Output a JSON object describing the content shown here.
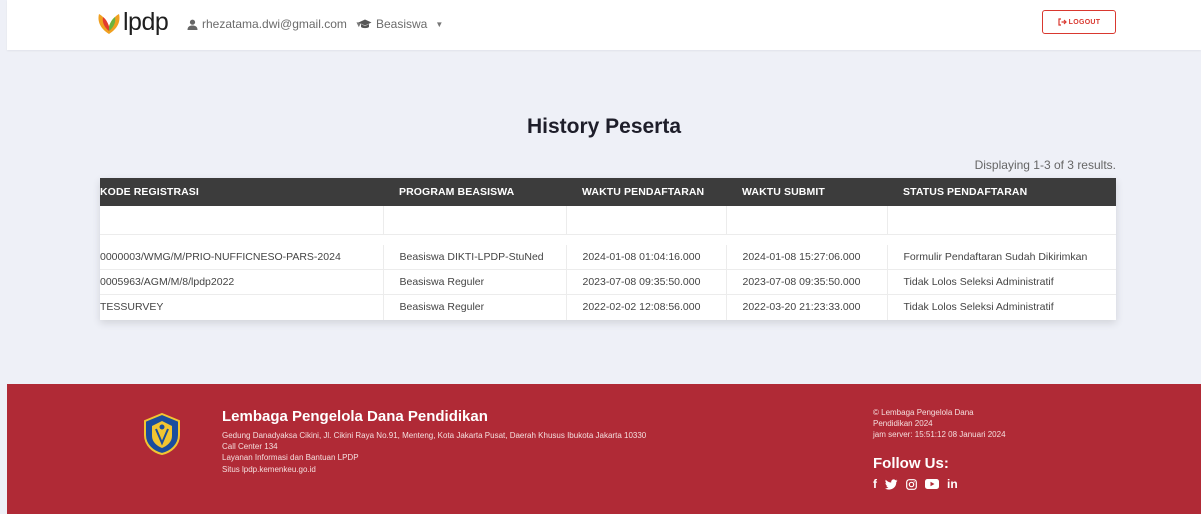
{
  "header": {
    "brand": "lpdp",
    "user_email": "rhezatama.dwi@gmail.com",
    "beasiswa_menu": "Beasiswa",
    "logout_label": "LOGOUT"
  },
  "main": {
    "title": "History Peserta",
    "summary": "Displaying 1-3 of 3 results.",
    "columns": [
      "KODE REGISTRASI",
      "PROGRAM BEASISWA",
      "WAKTU PENDAFTARAN",
      "WAKTU SUBMIT",
      "STATUS PENDAFTARAN"
    ],
    "rows": [
      [
        "0000003/WMG/M/PRIO-NUFFICNESO-PARS-2024",
        "Beasiswa DIKTI-LPDP-StuNed",
        "2024-01-08 01:04:16.000",
        "2024-01-08 15:27:06.000",
        "Formulir Pendaftaran Sudah Dikirimkan"
      ],
      [
        "0005963/AGM/M/8/lpdp2022",
        "Beasiswa Reguler",
        "2023-07-08 09:35:50.000",
        "2023-07-08 09:35:50.000",
        "Tidak Lolos Seleksi Administratif"
      ],
      [
        "TESSURVEY",
        "Beasiswa Reguler",
        "2022-02-02 12:08:56.000",
        "2022-03-20 21:23:33.000",
        "Tidak Lolos Seleksi Administratif"
      ]
    ]
  },
  "footer": {
    "org_name": "Lembaga Pengelola Dana Pendidikan",
    "address": "Gedung Danadyaksa Cikini, Jl. Cikini Raya No.91, Menteng, Kota Jakarta Pusat, Daerah Khusus Ibukota Jakarta 10330",
    "call_center": "Call Center 134",
    "help_service": "Layanan Informasi dan Bantuan LPDP",
    "site": "Situs lpdp.kemenkeu.go.id",
    "copyright_line1": "© Lembaga Pengelola Dana",
    "copyright_line2": "Pendidikan 2024",
    "server_time": "jam server: 15:51:12 08 Januari 2024",
    "follow_us": "Follow Us:",
    "socials": [
      "facebook-icon",
      "twitter-icon",
      "instagram-icon",
      "youtube-icon",
      "linkedin-icon"
    ]
  },
  "colors": {
    "accent": "#d9382f",
    "footer_bg": "#b02a36",
    "table_header_bg": "#3c3c3c",
    "page_bg": "#eef0f7"
  }
}
